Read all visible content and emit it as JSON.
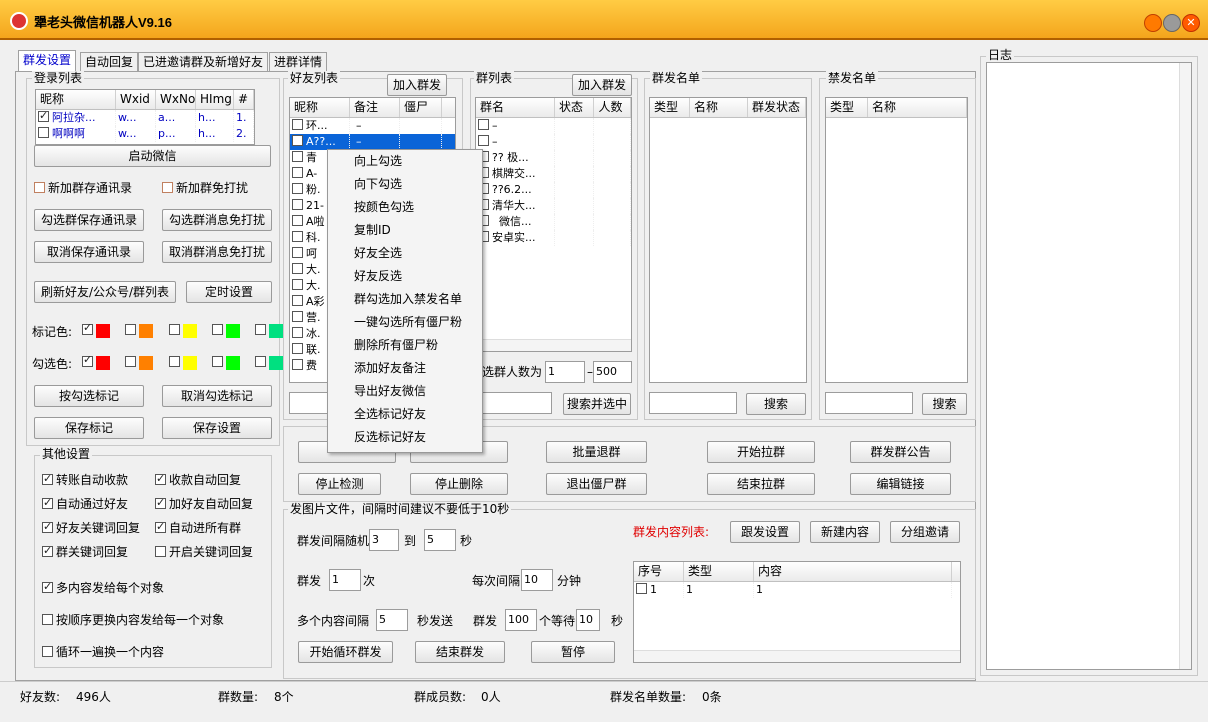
{
  "app": {
    "title": "犟老头微信机器人V9.16"
  },
  "tabs": [
    "群发设置",
    "自动回复",
    "已进邀请群及新增好友",
    "进群详情"
  ],
  "login": {
    "group_label": "登录列表",
    "columns": [
      "昵称",
      "Wxid",
      "WxNo",
      "HImg",
      "#"
    ],
    "rows": [
      {
        "name": "阿拉杂...",
        "wxid": "w...",
        "wxno": "a...",
        "himg": "h...",
        "num": "1."
      },
      {
        "name": "啊啊啊",
        "wxid": "w...",
        "wxno": "p...",
        "himg": "h...",
        "num": "2."
      }
    ],
    "start_btn": "启动微信"
  },
  "opts": {
    "new_save": "新加群存通讯录",
    "new_mute": "新加群免打扰",
    "sel_save": "勾选群保存通讯录",
    "sel_mute": "勾选群消息免打扰",
    "cancel_save": "取消保存通讯录",
    "cancel_mute": "取消群消息免打扰",
    "refresh": "刷新好友/公众号/群列表",
    "timer": "定时设置",
    "mark_color": "标记色:",
    "check_color": "勾选色:",
    "by_mark": "按勾选标记",
    "cancel_mark": "取消勾选标记",
    "save_mark": "保存标记",
    "save_settings": "保存设置"
  },
  "colors": {
    "red": "#ff0000",
    "orange": "#ff8000",
    "yellow": "#ffff00",
    "green": "#00ff00",
    "teal": "#00e080"
  },
  "other": {
    "label": "其他设置",
    "items": [
      "转账自动收款",
      "收款自动回复",
      "自动通过好友",
      "加好友自动回复",
      "好友关键词回复",
      "自动进所有群",
      "群关键词回复",
      "开启关键词回复"
    ],
    "multi": "多内容发给每个对象",
    "order": "按顺序更换内容发给每一个对象",
    "loop": "循环一遍换一个内容"
  },
  "friends": {
    "label": "好友列表",
    "add_btn": "加入群发",
    "columns": [
      "昵称",
      "备注",
      "僵尸"
    ],
    "rows": [
      {
        "name": "环...",
        "note": "–"
      },
      {
        "name": "A??...",
        "note": "–"
      },
      {
        "name": "青"
      },
      {
        "name": "A-"
      },
      {
        "name": "粉."
      },
      {
        "name": "21-"
      },
      {
        "name": "A啦"
      },
      {
        "name": "科."
      },
      {
        "name": "呵"
      },
      {
        "name": "大."
      },
      {
        "name": "大."
      },
      {
        "name": "A彩"
      },
      {
        "name": "营."
      },
      {
        "name": "冰."
      },
      {
        "name": "联."
      },
      {
        "name": "费"
      }
    ]
  },
  "groups": {
    "label": "群列表",
    "add_btn": "加入群发",
    "columns": [
      "群名",
      "状态",
      "人数"
    ],
    "rows": [
      "–",
      "–",
      "?? 极...",
      "棋牌交...",
      "??6.2...",
      "清华大...",
      "  微信...",
      "安卓实..."
    ],
    "filter_label": "选群人数为",
    "min": "1",
    "dash": "–",
    "max": "500",
    "search_select": "搜索并选中"
  },
  "sendlist": {
    "label": "群发名单",
    "columns": [
      "类型",
      "名称",
      "群发状态"
    ],
    "search": "搜索"
  },
  "banlist": {
    "label": "禁发名单",
    "columns": [
      "类型",
      "名称"
    ],
    "search": "搜索"
  },
  "actions": {
    "batch_quit": "批量退群",
    "start_pull": "开始拉群",
    "announce": "群发群公告",
    "stop_detect": "停止检测",
    "stop_delete": "停止删除",
    "quit_zombie": "退出僵尸群",
    "end_pull": "结束拉群",
    "edit_link": "编辑链接"
  },
  "send": {
    "label": "发图片文件，间隔时间建议不要低于10秒",
    "interval": "群发间隔随机",
    "i_from": "3",
    "to": "到",
    "i_to": "5",
    "sec": "秒",
    "times_label": "群发",
    "times": "1",
    "times_unit": "次",
    "each_interval": "每次间隔",
    "each_val": "10",
    "minute": "分钟",
    "multi_interval": "多个内容间隔",
    "multi_val": "5",
    "sec_send": "秒发送",
    "per_label": "群发",
    "per_val": "100",
    "per_wait": "个等待",
    "wait_val": "10",
    "wait_unit": "秒",
    "start_loop": "开始循环群发",
    "end_send": "结束群发",
    "pause": "暂停",
    "content_list": "群发内容列表:",
    "follow": "跟发设置",
    "new_content": "新建内容",
    "group_invite": "分组邀请",
    "content_cols": [
      "序号",
      "类型",
      "内容"
    ],
    "content_rows": [
      {
        "no": "1",
        "type": "1",
        "content": "1"
      }
    ]
  },
  "log": {
    "label": "日志"
  },
  "menu": [
    "向上勾选",
    "向下勾选",
    "按颜色勾选",
    "复制ID",
    "好友全选",
    "好友反选",
    "群勾选加入禁发名单",
    "一键勾选所有僵尸粉",
    "删除所有僵尸粉",
    "添加好友备注",
    "导出好友微信",
    "全选标记好友",
    "反选标记好友"
  ],
  "status": {
    "friends": "好友数:",
    "friends_val": "496人",
    "groups": "群数量:",
    "groups_val": "8个",
    "members": "群成员数:",
    "members_val": "0人",
    "sendcount": "群发名单数量:",
    "sendcount_val": "0条"
  }
}
